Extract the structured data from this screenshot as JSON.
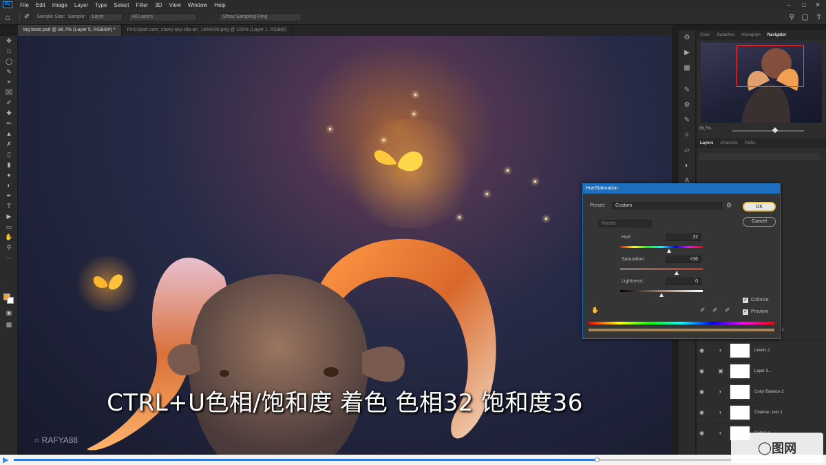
{
  "app": {
    "logo": "Ps"
  },
  "menu": [
    "File",
    "Edit",
    "Image",
    "Layer",
    "Type",
    "Select",
    "Filter",
    "3D",
    "View",
    "Window",
    "Help"
  ],
  "options_bar": {
    "sample_size_label": "Sample Size:",
    "sample_label": "Sample:",
    "sample_value": "Layer",
    "sample_all_layers": "All Layers",
    "show_sampling_ring": "Show Sampling Ring"
  },
  "tabs": [
    {
      "label": "big boss.psd @ 86.7% (Layer 5, RGB/8#) *",
      "active": true
    },
    {
      "label": "PinClipart.com_starry-sky-clip-art_1944436.png @ 100% (Layer 1, RGB/8)",
      "active": false
    }
  ],
  "canvas": {
    "caption": "CTRL+U色相/饱和度 着色 色相32 饱和度36",
    "watermark": "RAFYA88"
  },
  "panels": {
    "top_tabs": [
      "Color",
      "Swatches",
      "Histogram",
      "Navigator"
    ],
    "active_top_tab": "Navigator",
    "navigator_zoom": "86.7%",
    "navigator_zoom_fraction": 0.6,
    "layer_tabs": [
      "Layers",
      "Channels",
      "Paths"
    ],
    "layers": [
      {
        "name": "Color Balance 1",
        "type": "adjustment"
      },
      {
        "name": "Levels 2",
        "type": "levels"
      },
      {
        "name": "Layer 3...",
        "type": "pixel"
      },
      {
        "name": "Color Balance 2",
        "type": "adjustment"
      },
      {
        "name": "Channe...ixer 1",
        "type": "adjustment"
      },
      {
        "name": "Color Lo...",
        "type": "adjustment"
      }
    ]
  },
  "dialog": {
    "title": "Hue/Saturation",
    "preset_label": "Preset:",
    "preset_value": "Custom",
    "channel_value": "Master",
    "hue_label": "Hue:",
    "hue_value": "32",
    "hue_range": [
      -180,
      180
    ],
    "saturation_label": "Saturation:",
    "saturation_value": "+36",
    "saturation_range": [
      -100,
      100
    ],
    "lightness_label": "Lightness:",
    "lightness_value": "0",
    "lightness_range": [
      -100,
      100
    ],
    "ok_label": "OK",
    "cancel_label": "Cancel",
    "colorize_label": "Colorize",
    "colorize_checked": true,
    "preview_label": "Preview",
    "preview_checked": true
  },
  "video": {
    "progress_fraction": 0.77,
    "site_logo": "图网"
  },
  "colors": {
    "accent": "#1f6fbf",
    "foreground_swatch": "#f3a23b",
    "background_swatch": "#ffffff",
    "progress": "#2e7be0"
  }
}
